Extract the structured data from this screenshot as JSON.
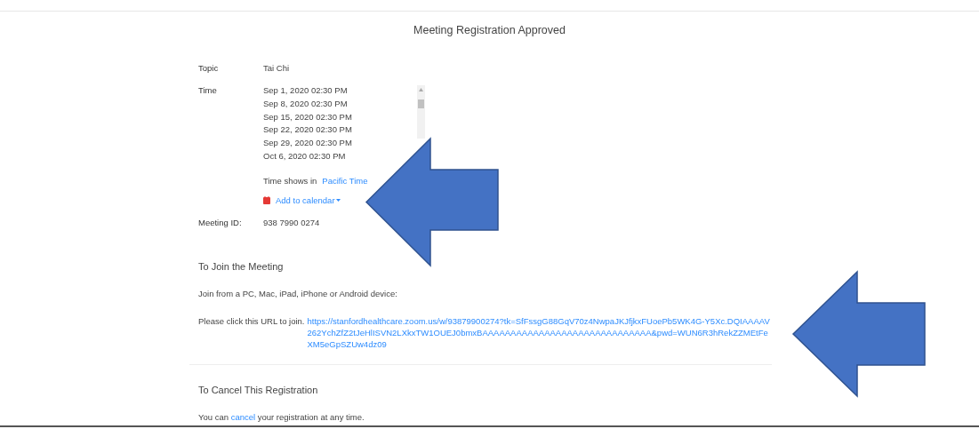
{
  "title": "Meeting Registration Approved",
  "details": [
    {
      "kind": "text",
      "label": "Topic",
      "value": "Tai Chi"
    },
    {
      "kind": "schedule",
      "label": "Time",
      "times": [
        "Sep 1, 2020 02:30 PM",
        "Sep 8, 2020 02:30 PM",
        "Sep 15, 2020 02:30 PM",
        "Sep 22, 2020 02:30 PM",
        "Sep 29, 2020 02:30 PM",
        "Oct 6, 2020 02:30 PM"
      ],
      "timezone_label": "Time shows in",
      "timezone": "Pacific Time",
      "calendar_link": "Add to calendar"
    },
    {
      "kind": "text",
      "label": "Meeting ID:",
      "value": "938 7990 0274"
    }
  ],
  "join": {
    "heading": "To Join the Meeting",
    "devices": "Join from a PC, Mac, iPad, iPhone or Android device:",
    "prompt": "Please click this URL to join.",
    "url": "https://stanfordhealthcare.zoom.us/w/93879900274?tk=SfFssgG88GqV70z4NwpaJKJfjkxFUoePb5WK4G-Y5Xc.DQIAAAAV262YchZfZ2tJeHlISVN2LXkxTW1OUEJ0bmxBAAAAAAAAAAAAAAAAAAAAAAAAAAAAAA&pwd=WUN6R3hRekZZMEtFeXM5eGpSZUw4dz09"
  },
  "cancel": {
    "heading": "To Cancel This Registration",
    "before": "You can",
    "link": "cancel",
    "after": "your registration at any time."
  },
  "annotations": [
    {
      "kind": "arrow"
    },
    {
      "kind": "arrow"
    }
  ]
}
